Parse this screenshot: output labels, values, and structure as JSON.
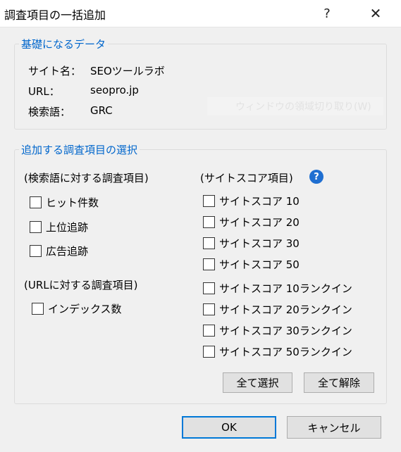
{
  "window": {
    "title": "調査項目の一括追加",
    "help_glyph": "?",
    "close_glyph": "✕"
  },
  "basic": {
    "title": "基礎になるデータ",
    "site_label": "サイト名：",
    "site_value": "SEOツールラボ",
    "url_label": "URL：",
    "url_value": "seopro.jp",
    "keyword_label": "検索語：",
    "keyword_value": "GRC",
    "ghost_text": "ウィンドウの領域切り取り(W)"
  },
  "selection": {
    "title": "追加する調査項目の選択",
    "keyword_section": "(検索語に対する調査項目)",
    "keyword_items": [
      "ヒット件数",
      "上位追跡",
      "広告追跡"
    ],
    "url_section": "(URLに対する調査項目)",
    "url_items": [
      "インデックス数"
    ],
    "site_section": "(サイトスコア項目)",
    "help_icon": "?",
    "site_items": [
      "サイトスコア 10",
      "サイトスコア 20",
      "サイトスコア 30",
      "サイトスコア 50"
    ],
    "rank_items": [
      "サイトスコア 10ランクイン",
      "サイトスコア 20ランクイン",
      "サイトスコア 30ランクイン",
      "サイトスコア 50ランクイン"
    ],
    "select_all": "全て選択",
    "clear_all": "全て解除"
  },
  "footer": {
    "ok": "OK",
    "cancel": "キャンセル"
  }
}
